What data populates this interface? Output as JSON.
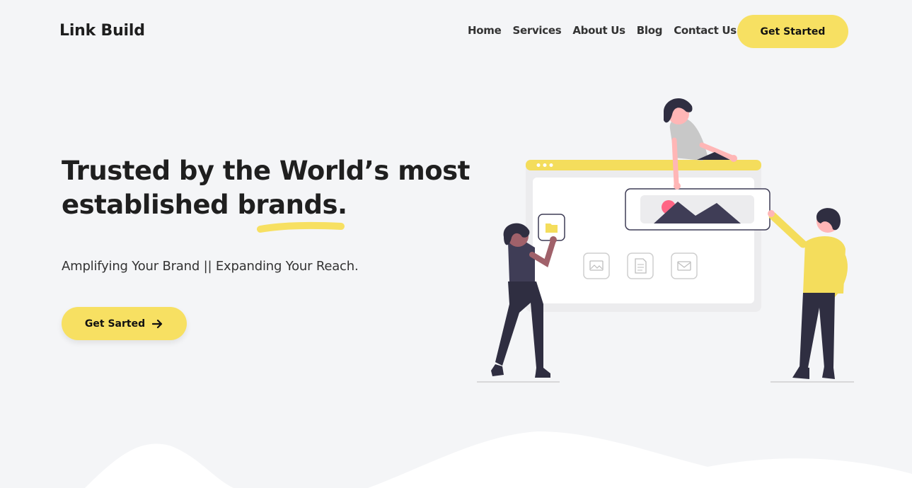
{
  "nav": {
    "brand": "Link Build",
    "links": [
      "Home",
      "Services",
      "About Us",
      "Blog",
      "Contact Us"
    ],
    "cta_label": "Get Started"
  },
  "hero": {
    "title_line1": "Trusted by the World’s most",
    "title_line2": "established brands.",
    "subtitle": "Amplifying Your Brand || Expanding Your Reach.",
    "cta_label": "Get Sarted",
    "cta_icon": "arrow-right-icon"
  },
  "colors": {
    "accent": "#f7e062",
    "background": "#f4f5f7",
    "text": "#1f1f1f"
  }
}
